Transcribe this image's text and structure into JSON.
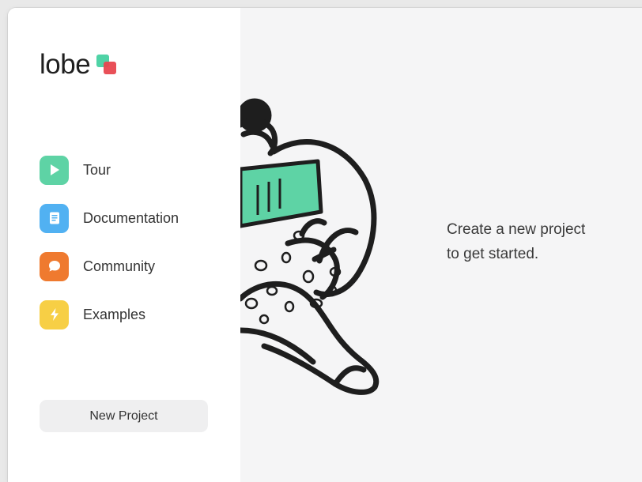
{
  "app": {
    "name": "lobe"
  },
  "sidebar": {
    "items": [
      {
        "label": "Tour",
        "icon": "play-icon",
        "color": "#5ed3a5"
      },
      {
        "label": "Documentation",
        "icon": "document-icon",
        "color": "#51b1f2"
      },
      {
        "label": "Community",
        "icon": "chat-bubble-icon",
        "color": "#ef7a2f"
      },
      {
        "label": "Examples",
        "icon": "lightning-icon",
        "color": "#f7cf45"
      }
    ],
    "new_project_label": "New Project"
  },
  "main": {
    "prompt_line1": "Create a new project",
    "prompt_line2": "to get started."
  },
  "colors": {
    "logo_green": "#4fd3a6",
    "logo_red": "#e8474f",
    "illustration_book": "#5ed3a5",
    "main_bg": "#f5f5f6"
  }
}
